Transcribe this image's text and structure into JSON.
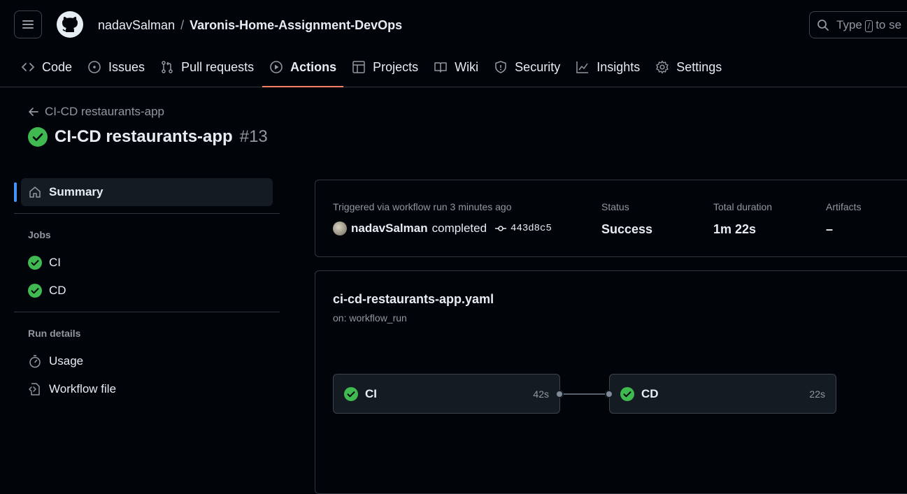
{
  "header": {
    "owner": "nadavSalman",
    "separator": "/",
    "repo": "Varonis-Home-Assignment-DevOps",
    "search": {
      "before": "Type",
      "key": "/",
      "after": "to se"
    }
  },
  "nav": {
    "tabs": [
      {
        "label": "Code",
        "icon": "code-icon"
      },
      {
        "label": "Issues",
        "icon": "issue-icon"
      },
      {
        "label": "Pull requests",
        "icon": "pull-request-icon"
      },
      {
        "label": "Actions",
        "icon": "play-icon",
        "active": true
      },
      {
        "label": "Projects",
        "icon": "table-icon"
      },
      {
        "label": "Wiki",
        "icon": "book-icon"
      },
      {
        "label": "Security",
        "icon": "shield-icon"
      },
      {
        "label": "Insights",
        "icon": "graph-icon"
      },
      {
        "label": "Settings",
        "icon": "gear-icon"
      }
    ]
  },
  "run": {
    "back_label": "CI-CD restaurants-app",
    "title": "CI-CD restaurants-app",
    "number": "#13"
  },
  "sidebar": {
    "summary_label": "Summary",
    "jobs_heading": "Jobs",
    "jobs": [
      {
        "label": "CI"
      },
      {
        "label": "CD"
      }
    ],
    "run_details_heading": "Run details",
    "details": [
      {
        "label": "Usage",
        "icon": "stopwatch-icon"
      },
      {
        "label": "Workflow file",
        "icon": "file-code-icon"
      }
    ]
  },
  "summary": {
    "trigger_label": "Triggered via workflow run 3 minutes ago",
    "actor": "nadavSalman",
    "action": "completed",
    "commit": "443d8c5",
    "status_label": "Status",
    "status_value": "Success",
    "duration_label": "Total duration",
    "duration_value": "1m 22s",
    "artifacts_label": "Artifacts",
    "artifacts_value": "–"
  },
  "workflow": {
    "file": "ci-cd-restaurants-app.yaml",
    "on": "on: workflow_run",
    "jobs": [
      {
        "name": "CI",
        "duration": "42s"
      },
      {
        "name": "CD",
        "duration": "22s"
      }
    ]
  },
  "colors": {
    "success": "#3fb950",
    "accent": "#f78166",
    "selection": "#4493f8"
  }
}
